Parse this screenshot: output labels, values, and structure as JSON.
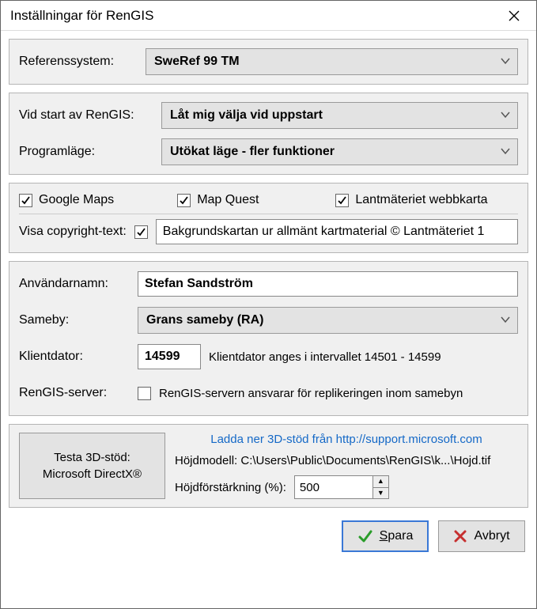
{
  "window": {
    "title": "Inställningar för RenGIS"
  },
  "reference_system": {
    "label": "Referenssystem:",
    "value": "SweRef 99 TM"
  },
  "startup": {
    "label": "Vid start av RenGIS:",
    "value": "Låt mig välja vid uppstart"
  },
  "program_mode": {
    "label": "Programläge:",
    "value": "Utökat läge - fler funktioner"
  },
  "maps": {
    "google": {
      "label": "Google Maps",
      "checked": true
    },
    "mapquest": {
      "label": "Map Quest",
      "checked": true
    },
    "lantmateriet": {
      "label": "Lantmäteriet webbkarta",
      "checked": true
    }
  },
  "copyright": {
    "label": "Visa copyright-text:",
    "checked": true,
    "value": "Bakgrundskartan ur allmänt kartmaterial © Lantmäteriet 1"
  },
  "user": {
    "name_label": "Användarnamn:",
    "name_value": "Stefan Sandström",
    "sameby_label": "Sameby:",
    "sameby_value": "Grans sameby (RA)",
    "client_label": "Klientdator:",
    "client_value": "14599",
    "client_hint": "Klientdator anges i intervallet 14501 - 14599",
    "server_label": "RenGIS-server:",
    "server_checked": false,
    "server_hint": "RenGIS-servern ansvarar för replikeringen inom samebyn"
  },
  "threeD": {
    "test_button_line1": "Testa 3D-stöd:",
    "test_button_line2": "Microsoft DirectX®",
    "download_link": "Ladda ner 3D-stöd från http://support.microsoft.com",
    "height_model_label": "Höjdmodell: C:\\Users\\Public\\Documents\\RenGIS\\k...\\Hojd.tif",
    "gain_label": "Höjdförstärkning (%):",
    "gain_value": "500"
  },
  "actions": {
    "save": "Spara",
    "cancel": "Avbryt"
  }
}
